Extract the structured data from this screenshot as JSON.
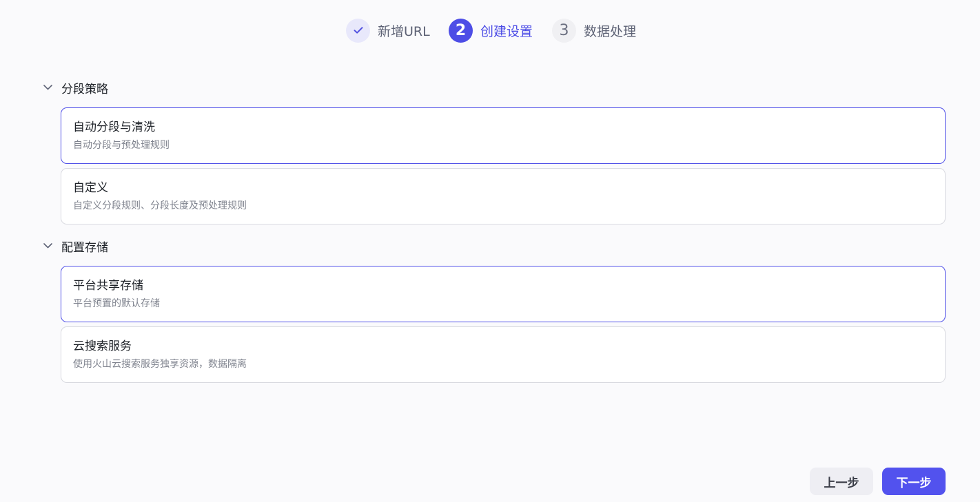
{
  "stepper": {
    "steps": [
      {
        "number": "",
        "label": "新增URL",
        "state": "done",
        "icon": "check-icon"
      },
      {
        "number": "2",
        "label": "创建设置",
        "state": "active"
      },
      {
        "number": "3",
        "label": "数据处理",
        "state": "todo"
      }
    ]
  },
  "sections": [
    {
      "title": "分段策略",
      "icon": "chevron-down-icon",
      "options": [
        {
          "title": "自动分段与清洗",
          "desc": "自动分段与预处理规则",
          "selected": true
        },
        {
          "title": "自定义",
          "desc": "自定义分段规则、分段长度及预处理规则",
          "selected": false
        }
      ]
    },
    {
      "title": "配置存储",
      "icon": "chevron-down-icon",
      "options": [
        {
          "title": "平台共享存储",
          "desc": "平台预置的默认存储",
          "selected": true
        },
        {
          "title": "云搜索服务",
          "desc": "使用火山云搜索服务独享资源，数据隔离",
          "selected": false
        }
      ]
    }
  ],
  "footer": {
    "prev_label": "上一步",
    "next_label": "下一步"
  },
  "colors": {
    "accent": "#4d4de6",
    "background": "#fafafc",
    "card_border": "#d9dae0",
    "selected_border": "#5151e8"
  }
}
